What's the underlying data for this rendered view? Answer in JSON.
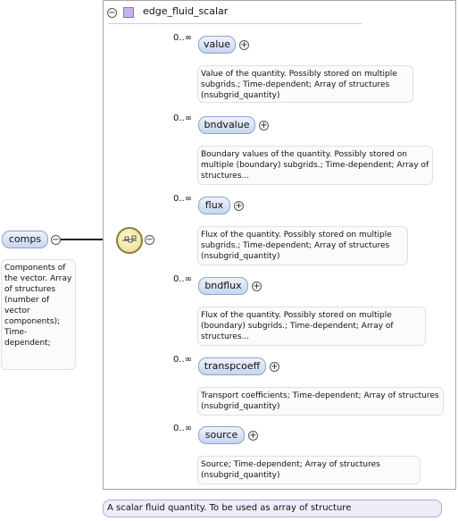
{
  "root": {
    "name": "comps",
    "description": "Components of the vector. Array of structures (number of vector components); Time-dependent;"
  },
  "type": {
    "name": "edge_fluid_scalar",
    "description": "A scalar fluid quantity. To be used as array of structure"
  },
  "children": [
    {
      "name": "value",
      "multiplicity": "0..∞",
      "description": "Value of the quantity. Possibly stored on multiple subgrids.; Time-dependent; Array of structures (nsubgrid_quantity)"
    },
    {
      "name": "bndvalue",
      "multiplicity": "0..∞",
      "description": "Boundary values of the quantity. Possibly stored on multiple (boundary) subgrids.; Time-dependent; Array of structures..."
    },
    {
      "name": "flux",
      "multiplicity": "0..∞",
      "description": "Flux of the quantity. Possibly stored on multiple subgrids.; Time-dependent; Array of structures (nsubgrid_quantity)"
    },
    {
      "name": "bndflux",
      "multiplicity": "0..∞",
      "description": "Flux of the quantity. Possibly stored on multiple (boundary) subgrids.; Time-dependent; Array of structures..."
    },
    {
      "name": "transpcoeff",
      "multiplicity": "0..∞",
      "description": "Transport coefficients; Time-dependent; Array of structures (nsubgrid_quantity)"
    },
    {
      "name": "source",
      "multiplicity": "0..∞",
      "description": "Source; Time-dependent; Array of structures (nsubgrid_quantity)"
    }
  ],
  "controls": {
    "collapse_symbol": "−",
    "expand_symbol": "+"
  },
  "icons": {
    "type_icon": "complex-type-icon",
    "sequence_icon": "sequence-compositor-icon"
  },
  "colors": {
    "element_fill": "#c6d5ef",
    "type_fill": "#c7b2ec",
    "sequence_fill": "#e8d989"
  }
}
